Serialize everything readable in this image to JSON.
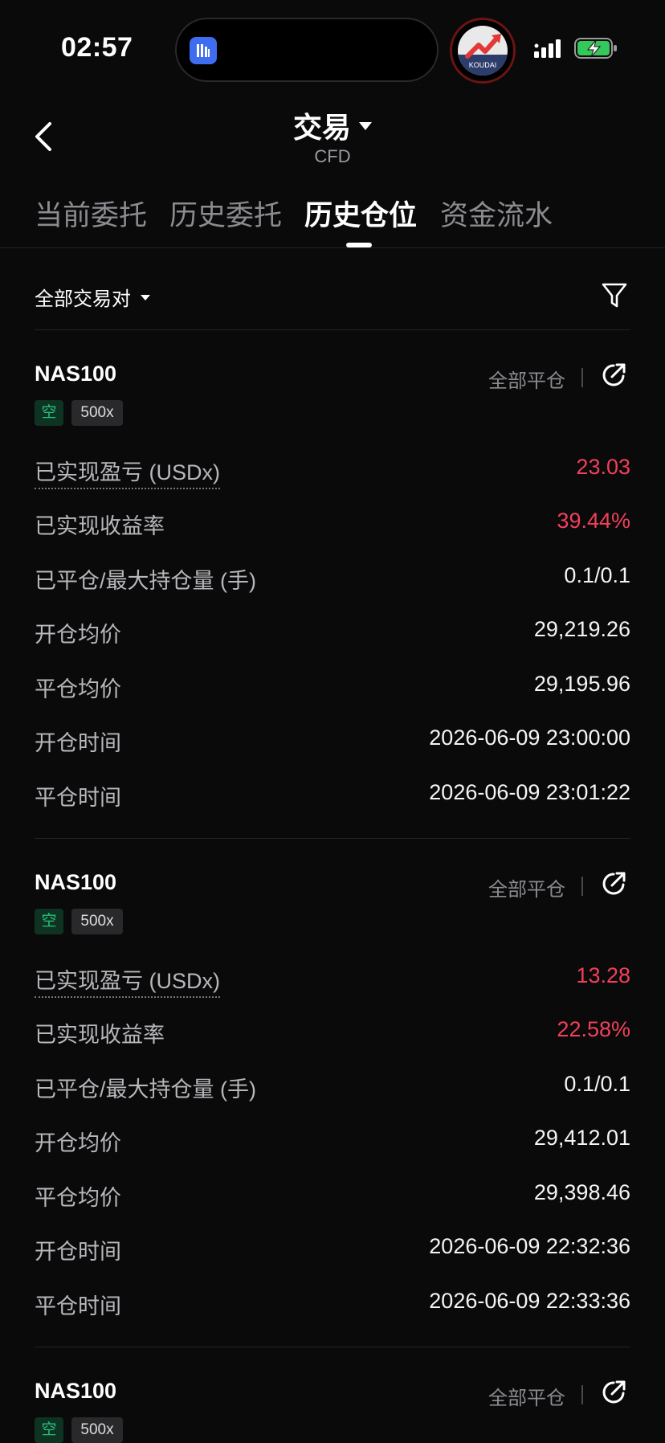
{
  "status": {
    "time": "02:57",
    "island_app_icon": "dashboard-app-icon",
    "recording_app_label": "KOUDAI"
  },
  "header": {
    "title": "交易",
    "subtitle": "CFD"
  },
  "tabs": [
    {
      "label": "当前委托",
      "active": false
    },
    {
      "label": "历史委托",
      "active": false
    },
    {
      "label": "历史仓位",
      "active": true
    },
    {
      "label": "资金流水",
      "active": false
    }
  ],
  "filter": {
    "label": "全部交易对"
  },
  "colors": {
    "background": "#0a0a0b",
    "profit": "#f0405a",
    "short": "#27c07a"
  },
  "cards": [
    {
      "symbol": "NAS100",
      "side": "空",
      "leverage": "500x",
      "close_all": "全部平仓",
      "rows": [
        {
          "label": "已实现盈亏 (USDx)",
          "value": "23.03"
        },
        {
          "label": "已实现收益率",
          "value": "39.44%"
        },
        {
          "label": "已平仓/最大持仓量 (手)",
          "value": "0.1/0.1"
        },
        {
          "label": "开仓均价",
          "value": "29,219.26"
        },
        {
          "label": "平仓均价",
          "value": "29,195.96"
        },
        {
          "label": "开仓时间",
          "value": "2026-06-09 23:00:00"
        },
        {
          "label": "平仓时间",
          "value": "2026-06-09 23:01:22"
        }
      ]
    },
    {
      "symbol": "NAS100",
      "side": "空",
      "leverage": "500x",
      "close_all": "全部平仓",
      "rows": [
        {
          "label": "已实现盈亏 (USDx)",
          "value": "13.28"
        },
        {
          "label": "已实现收益率",
          "value": "22.58%"
        },
        {
          "label": "已平仓/最大持仓量 (手)",
          "value": "0.1/0.1"
        },
        {
          "label": "开仓均价",
          "value": "29,412.01"
        },
        {
          "label": "平仓均价",
          "value": "29,398.46"
        },
        {
          "label": "开仓时间",
          "value": "2026-06-09 22:32:36"
        },
        {
          "label": "平仓时间",
          "value": "2026-06-09 22:33:36"
        }
      ]
    },
    {
      "symbol": "NAS100",
      "side": "空",
      "leverage": "500x",
      "close_all": "全部平仓",
      "rows": []
    }
  ]
}
